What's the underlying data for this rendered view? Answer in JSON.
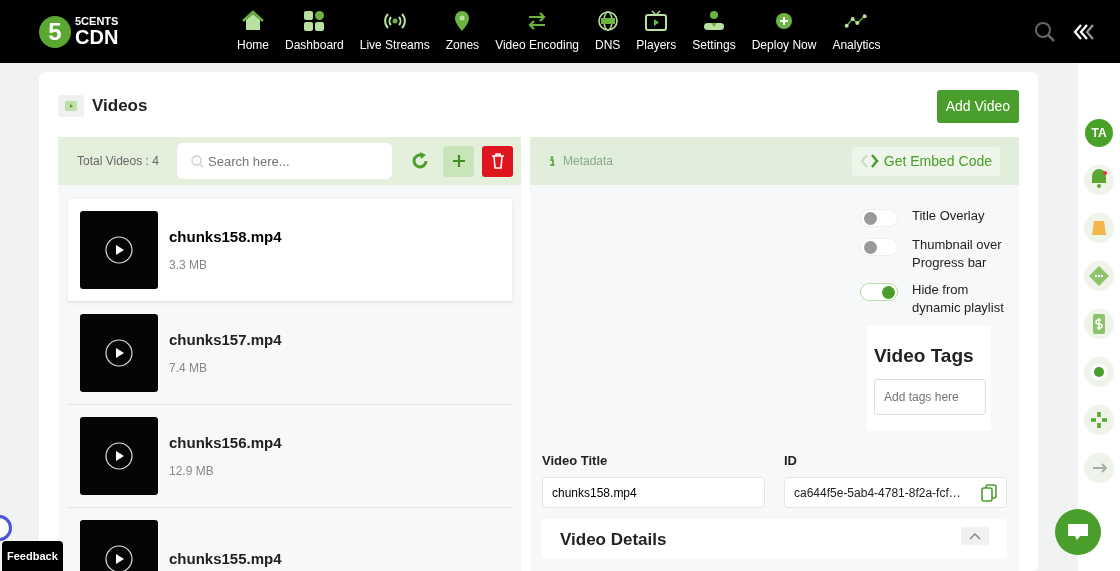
{
  "brand": {
    "mark": "5",
    "top": "5CENTS",
    "bottom": "CDN"
  },
  "nav": [
    {
      "label": "Home"
    },
    {
      "label": "Dashboard"
    },
    {
      "label": "Live Streams"
    },
    {
      "label": "Zones"
    },
    {
      "label": "Video Encoding"
    },
    {
      "label": "DNS"
    },
    {
      "label": "Players"
    },
    {
      "label": "Settings"
    },
    {
      "label": "Deploy Now"
    },
    {
      "label": "Analytics"
    }
  ],
  "page": {
    "title": "Videos",
    "add_button": "Add Video"
  },
  "list": {
    "total": "Total Videos : 4",
    "search_placeholder": "Search here...",
    "videos": [
      {
        "name": "chunks158.mp4",
        "size": "3.3 MB",
        "selected": true
      },
      {
        "name": "chunks157.mp4",
        "size": "7.4 MB",
        "selected": false
      },
      {
        "name": "chunks156.mp4",
        "size": "12.9 MB",
        "selected": false
      },
      {
        "name": "chunks155.mp4",
        "selected": false
      }
    ]
  },
  "detail": {
    "tab": "Metadata",
    "embed_button": "Get Embed Code",
    "toggles": [
      {
        "label": "Title Overlay",
        "on": false
      },
      {
        "label": "Thumbnail over Progress bar",
        "on": false
      },
      {
        "label": "Hide from dynamic playlist",
        "on": true
      }
    ],
    "tags": {
      "title": "Video Tags",
      "placeholder": "Add tags here"
    },
    "fields": [
      {
        "label": "Video Title",
        "value": "chunks158.mp4",
        "kind": "text"
      },
      {
        "label": "ID",
        "value": "ca644f5e-5ab4-4781-8f2a-fcf…",
        "kind": "copy"
      }
    ],
    "section": "Video Details"
  },
  "rail": {
    "avatar": "TA"
  },
  "feedback": "Feedback"
}
